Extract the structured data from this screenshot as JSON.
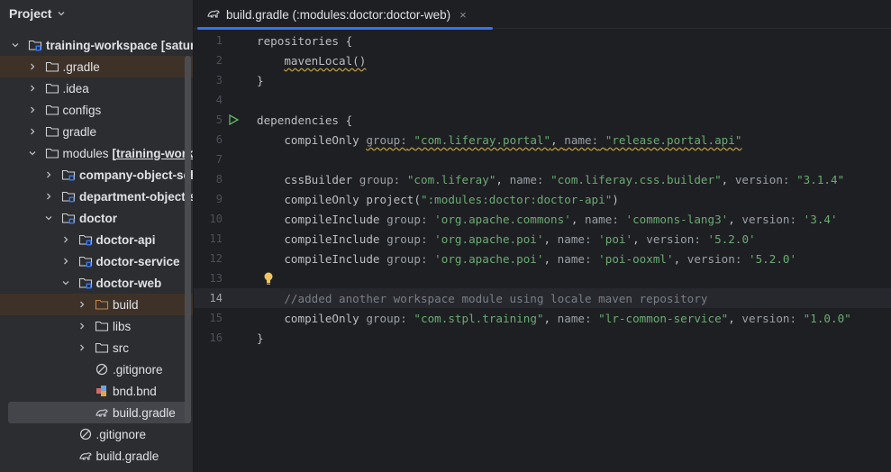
{
  "project_panel": {
    "title": "Project",
    "tree": [
      {
        "label": "training-workspace",
        "extra": "[satur",
        "depth": 0,
        "expanded": true,
        "icon": "module-folder-icon"
      },
      {
        "label": ".gradle",
        "depth": 1,
        "expanded": false,
        "icon": "folder-icon"
      },
      {
        "label": ".idea",
        "depth": 1,
        "expanded": false,
        "icon": "folder-icon"
      },
      {
        "label": "configs",
        "depth": 1,
        "expanded": false,
        "icon": "folder-icon"
      },
      {
        "label": "gradle",
        "depth": 1,
        "expanded": false,
        "icon": "folder-icon"
      },
      {
        "label": "modules",
        "extra": "[training-work",
        "depth": 1,
        "expanded": true,
        "icon": "folder-icon"
      },
      {
        "label": "company-object-sch",
        "depth": 2,
        "expanded": false,
        "icon": "module-folder-icon"
      },
      {
        "label": "department-object-s",
        "depth": 2,
        "expanded": false,
        "icon": "module-folder-icon"
      },
      {
        "label": "doctor",
        "depth": 2,
        "expanded": true,
        "icon": "module-folder-icon"
      },
      {
        "label": "doctor-api",
        "depth": 3,
        "expanded": false,
        "icon": "module-folder-icon"
      },
      {
        "label": "doctor-service",
        "depth": 3,
        "expanded": false,
        "icon": "module-folder-icon"
      },
      {
        "label": "doctor-web",
        "depth": 3,
        "expanded": true,
        "icon": "module-folder-icon"
      },
      {
        "label": "build",
        "depth": 4,
        "expanded": false,
        "icon": "excluded-folder-icon"
      },
      {
        "label": "libs",
        "depth": 4,
        "expanded": false,
        "icon": "folder-icon"
      },
      {
        "label": "src",
        "depth": 4,
        "expanded": false,
        "icon": "folder-icon"
      },
      {
        "label": ".gitignore",
        "depth": 4,
        "icon": "gitignore-icon"
      },
      {
        "label": "bnd.bnd",
        "depth": 4,
        "icon": "bnd-file-icon"
      },
      {
        "label": "build.gradle",
        "depth": 4,
        "icon": "gradle-file-icon"
      },
      {
        "label": ".gitignore",
        "depth": 3,
        "icon": "gitignore-icon"
      },
      {
        "label": "build.gradle",
        "depth": 3,
        "icon": "gradle-file-icon"
      }
    ]
  },
  "editor": {
    "tab": {
      "title": "build.gradle (:modules:doctor:doctor-web)",
      "close": "×"
    },
    "current_line": 14,
    "lines": [
      {
        "n": "1",
        "text": "repositories {"
      },
      {
        "n": "2",
        "text": "    mavenLocal()"
      },
      {
        "n": "3",
        "text": "}"
      },
      {
        "n": "4",
        "text": ""
      },
      {
        "n": "5",
        "text": "dependencies {"
      },
      {
        "n": "6",
        "text": "    compileOnly group: \"com.liferay.portal\", name: \"release.portal.api\""
      },
      {
        "n": "7",
        "text": ""
      },
      {
        "n": "8",
        "text": "    cssBuilder group: \"com.liferay\", name: \"com.liferay.css.builder\", version: \"3.1.4\""
      },
      {
        "n": "9",
        "text": "    compileOnly project(\":modules:doctor:doctor-api\")"
      },
      {
        "n": "10",
        "text": "    compileInclude group: 'org.apache.commons', name: 'commons-lang3', version: '3.4'"
      },
      {
        "n": "11",
        "text": "    compileInclude group: 'org.apache.poi', name: 'poi', version: '5.2.0'"
      },
      {
        "n": "12",
        "text": "    compileInclude group: 'org.apache.poi', name: 'poi-ooxml', version: '5.2.0'"
      },
      {
        "n": "13",
        "text": ""
      },
      {
        "n": "14",
        "text": "    //added another workspace module using locale maven repository"
      },
      {
        "n": "15",
        "text": "    compileOnly group: \"com.stpl.training\", name: \"lr-common-service\", version: \"1.0.0\""
      },
      {
        "n": "16",
        "text": "}"
      }
    ]
  }
}
